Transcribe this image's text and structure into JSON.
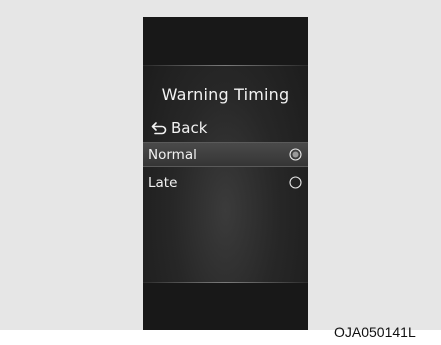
{
  "screen": {
    "title": "Warning Timing",
    "back": {
      "label": "Back",
      "icon": "back-arrow-icon"
    },
    "options": [
      {
        "label": "Normal",
        "selected": true,
        "icon": "radio-selected-icon"
      },
      {
        "label": "Late",
        "selected": false,
        "icon": "radio-unselected-icon"
      }
    ]
  },
  "figure_code": "OJA050141L",
  "colors": {
    "screen_bg": "#2a2a2a",
    "text": "#f2f2f2",
    "selected_row": "#404040",
    "panel_bg": "#e6e6e6"
  }
}
